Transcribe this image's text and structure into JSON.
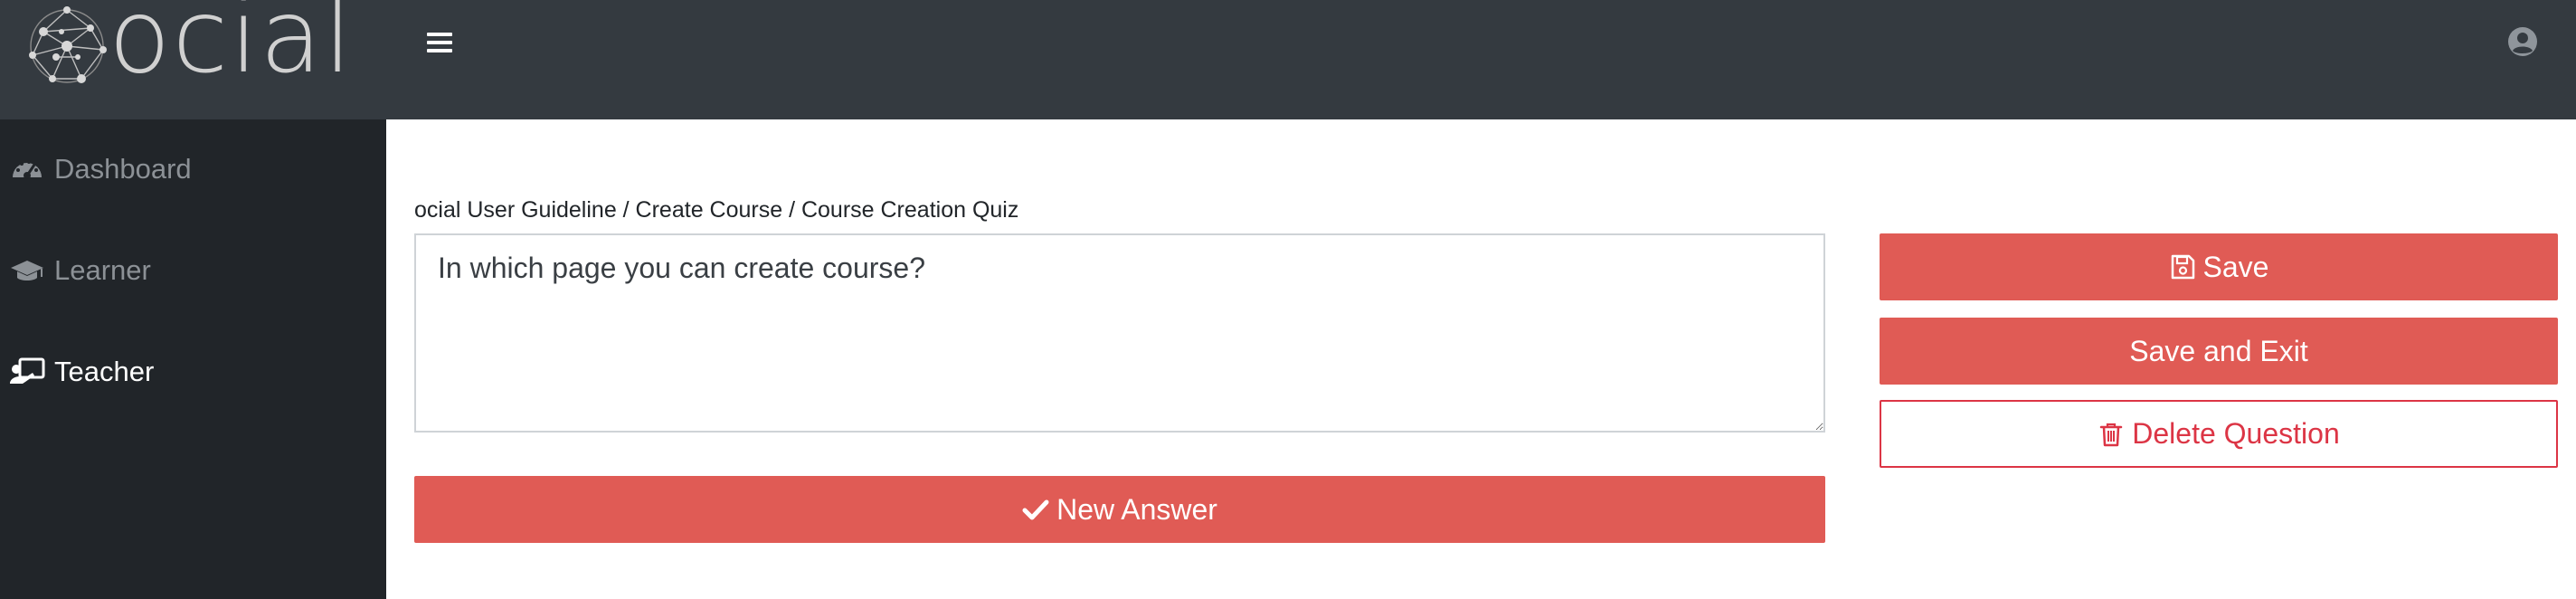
{
  "brand": {
    "name": "ocial"
  },
  "header": {
    "menu_icon": "hamburger-icon",
    "user_icon": "user-circle-icon"
  },
  "sidebar": {
    "items": [
      {
        "label": "Dashboard",
        "icon": "tachometer-icon",
        "active": false
      },
      {
        "label": "Learner",
        "icon": "graduation-cap-icon",
        "active": false
      },
      {
        "label": "Teacher",
        "icon": "chalkboard-teacher-icon",
        "active": true
      }
    ]
  },
  "main": {
    "breadcrumb": "ocial User Guideline / Create Course / Course Creation Quiz",
    "question_text": "In which page you can create course?",
    "new_answer_label": "New Answer",
    "new_answer_icon": "check-icon"
  },
  "actions": {
    "save_label": "Save",
    "save_icon": "floppy-disk-icon",
    "save_exit_label": "Save and Exit",
    "delete_label": "Delete Question",
    "delete_icon": "trash-icon"
  },
  "colors": {
    "topbar": "#343a40",
    "sidebar": "#212529",
    "accent": "#e05b55",
    "danger": "#dc3545"
  }
}
